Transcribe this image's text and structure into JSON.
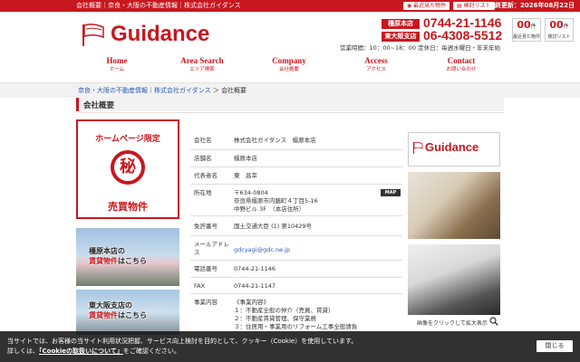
{
  "topbar": {
    "links": "会社概要｜奈良・大阪の不動産情報｜株式会社ガイダンス",
    "recent_btn": "最近見た物件",
    "review_btn": "検討リスト",
    "updated_label": "最終更新：",
    "updated_date": "2026年08月22日"
  },
  "logo": {
    "text": "Guidance"
  },
  "contact": {
    "branch1_tag": "橿原本店",
    "branch1_tel": "0744-21-1146",
    "branch2_tag": "東大阪支店",
    "branch2_tel": "06-4308-5512",
    "hours": "営業時間：10：00~18：00 定休日：毎週水曜日・年末年始"
  },
  "counters": [
    {
      "count": "00",
      "unit": "件",
      "label": "最近見た物件"
    },
    {
      "count": "00",
      "unit": "件",
      "label": "検討リスト"
    }
  ],
  "nav": [
    {
      "en": "Home",
      "jp": "ホーム"
    },
    {
      "en": "Area Search",
      "jp": "エリア検索"
    },
    {
      "en": "Company",
      "jp": "会社概要"
    },
    {
      "en": "Access",
      "jp": "アクセス"
    },
    {
      "en": "Contact",
      "jp": "お問い合わせ"
    }
  ],
  "breadcrumb": {
    "link1": "奈良・大阪の不動産情報",
    "sep1": "｜",
    "link2": "株式会社ガイダンス",
    "sep2": "＞",
    "current": "会社概要"
  },
  "page_title": "会社概要",
  "sidebar": {
    "banner_top": "ホームページ限定",
    "banner_mark": "秘",
    "banner_bottom": "売買物件",
    "link1_a": "橿原本店の",
    "link1_b": "賃貸物件",
    "link1_c": "はこちら",
    "link2_a": "東大阪支店の",
    "link2_b": "賃貸物件",
    "link2_c": "はこちら"
  },
  "info": {
    "company_k": "会社名",
    "company_v": "株式会社ガイダンス　橿原本店",
    "store_k": "店舗名",
    "store_v": "橿原本店",
    "rep_k": "代表者名",
    "rep_v": "東　昌幸",
    "addr_k": "所在地",
    "addr_zip": "〒634-0804",
    "addr_1": "奈良県橿原市内膳町４丁目5-16",
    "addr_2": "中野ビル 3F　（本店住所）",
    "map": "MAP",
    "license_k": "免許番号",
    "license_v": "国土交通大臣 (1) 第10429号",
    "mail_k": "メールアドレス",
    "mail_v": "gdcyagi@gdc.ne.jp",
    "tel_k": "電話番号",
    "tel_v": "0744-21-1146",
    "fax_k": "FAX",
    "fax_v": "0744-21-1147",
    "biz_k": "事業内容",
    "biz_0": "《事業内容》",
    "biz_1": "１：不動産全般の仲介（売買、賃貸）",
    "biz_2": "２：不動産賃貸管理、保守業務",
    "biz_3": "３：住居用・事業用のリフォーム工事全般請負"
  },
  "gallery": {
    "caption": "画像をクリックして拡大表示"
  },
  "cookie": {
    "line1": "当サイトでは、お客様の当サイト利用状況把握、サービス向上検討を目的として、クッキー（Cookie）を使用しています。",
    "line2_pre": "詳しくは、",
    "line2_link": "「Cookieの取扱いについて」",
    "line2_post": "をご確認ください。",
    "close": "閉じる"
  },
  "colors": {
    "brand": "#c8171e",
    "link": "#2a5db0"
  }
}
